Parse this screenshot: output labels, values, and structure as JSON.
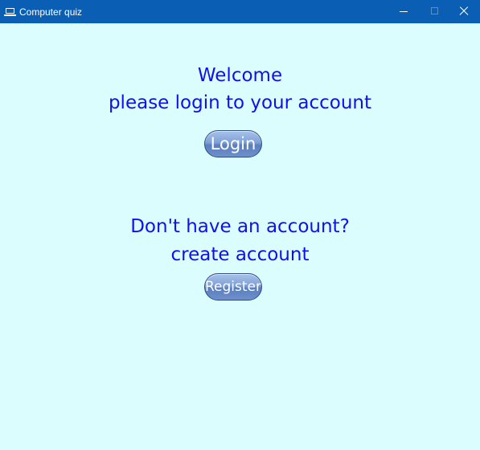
{
  "window": {
    "title": "Computer quiz"
  },
  "welcome": {
    "heading": "Welcome",
    "subheading": "please login to your account",
    "login_label": "Login"
  },
  "register": {
    "question": "Don't have an account?",
    "prompt": "create account",
    "register_label": "Register"
  },
  "icons": {
    "app": "laptop-icon",
    "minimize": "minimize-icon",
    "maximize": "maximize-icon",
    "close": "close-icon"
  },
  "colors": {
    "titlebar": "#0a5fb4",
    "background": "#dcfdfd",
    "text": "#1010ee",
    "button": "#7fa1d7"
  }
}
